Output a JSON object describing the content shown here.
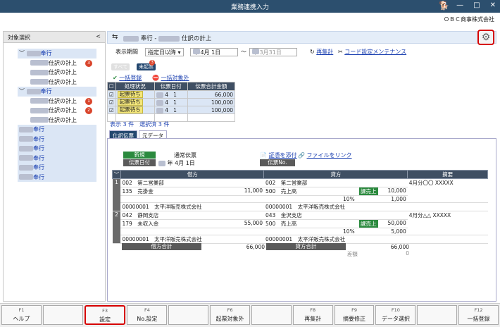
{
  "window": {
    "title": "業務連携入力",
    "company": "ＯＢＣ商事株式会社"
  },
  "left_panel": {
    "title": "対象選択",
    "collapse": "<",
    "tree": [
      {
        "label": "奉行",
        "type": "bank",
        "indent": 0,
        "expand": "﹀"
      },
      {
        "label": "仕訳の計上",
        "indent": 1,
        "badge": "3",
        "badge_color": "#d9442b"
      },
      {
        "label": "仕訳の計上",
        "indent": 1
      },
      {
        "label": "仕訳の計上",
        "indent": 1
      },
      {
        "label": "奉行",
        "type": "bank",
        "indent": 0,
        "expand": "﹀"
      },
      {
        "label": "仕訳の計上",
        "indent": 1,
        "badge": "1",
        "badge_color": "#d9442b"
      },
      {
        "label": "仕訳の計上",
        "indent": 1,
        "badge": "2",
        "badge_color": "#d9442b"
      },
      {
        "label": "仕訳の計上",
        "indent": 1
      },
      {
        "label": "奉行",
        "type": "bank",
        "indent": 0
      },
      {
        "label": "奉行",
        "type": "bank",
        "indent": 0
      },
      {
        "label": "奉行",
        "type": "bank",
        "indent": 0
      },
      {
        "label": "奉行",
        "type": "bank",
        "indent": 0
      },
      {
        "label": "奉行",
        "type": "bank",
        "indent": 0
      },
      {
        "label": "奉行",
        "type": "bank",
        "indent": 0
      }
    ]
  },
  "main": {
    "header": {
      "bank": "奉行",
      "separator": "-",
      "entry": "仕訳の計上"
    },
    "filter": {
      "period_label": "表示期間",
      "period_select": "指定日以降",
      "from_date": "年  4月  1日",
      "tilde": "～",
      "to_date": "年  3月31日",
      "recalc": "再集計",
      "code_setting": "コード設定メンテナンス"
    },
    "chips": {
      "all": "すべて",
      "unposted": "未起票",
      "unposted_count": "3"
    },
    "actions": {
      "bulk_register": "一括登録",
      "bulk_exclude": "一括対象外"
    },
    "list": {
      "columns": [
        "処理状況",
        "伝票日付",
        "伝票合計金額"
      ],
      "rows": [
        {
          "status": "起票待ち",
          "month": "4",
          "day": "1",
          "amount": "66,000"
        },
        {
          "status": "起票待ち",
          "month": "4",
          "day": "1",
          "amount": "100,000"
        },
        {
          "status": "起票待ち",
          "month": "4",
          "day": "1",
          "amount": "100,000"
        }
      ],
      "summary": "表示 3 件　選択済 3 件"
    },
    "detail": {
      "tabs": [
        "仕訳伝票",
        "元データ"
      ],
      "new_button": "新規",
      "voucher_type": "通常伝票",
      "date_label": "伝票日付",
      "date_value": "年  4月  1日",
      "voucher_no_label": "伝票No.",
      "attach": "証憑を添付",
      "file_link": "ファイルをリンク",
      "columns": {
        "debit": "借方",
        "credit": "貸方",
        "memo": "摘要"
      },
      "entries": [
        {
          "no": "1",
          "debit_dept": "002　第二営業部",
          "debit_acct": "135　売掛金",
          "debit_amount": "11,000",
          "debit_partner": "00000001　太平洋販売株式会社",
          "credit_dept": "002　第二営業部",
          "credit_acct": "500　売上高",
          "credit_tax": "課売上",
          "credit_rate": "10%",
          "credit_amount": "10,000",
          "credit_tax_amount": "1,000",
          "credit_partner": "00000001　太平洋販売株式会社",
          "memo": "4月分〇〇 XXXXX"
        },
        {
          "no": "2",
          "debit_dept": "042　静岡支店",
          "debit_acct": "179　未収入金",
          "debit_amount": "55,000",
          "debit_partner": "00000001　太平洋販売株式会社",
          "credit_dept": "043　金沢支店",
          "credit_acct": "500　売上高",
          "credit_tax": "課売上",
          "credit_rate": "10%",
          "credit_amount": "50,000",
          "credit_tax_amount": "5,000",
          "credit_partner": "00000001　太平洋販売株式会社",
          "memo": "4月分△△ XXXXX"
        }
      ],
      "totals": {
        "debit_label": "借方合計",
        "debit_value": "66,000",
        "credit_label": "貸方合計",
        "credit_value": "66,000",
        "diff_label": "差額",
        "diff_value": "0"
      }
    }
  },
  "fkeys": [
    {
      "key": "F1",
      "label": "ヘルプ"
    },
    {
      "key": "",
      "label": ""
    },
    {
      "key": "F3",
      "label": "設定",
      "highlight": true
    },
    {
      "key": "F4",
      "label": "No.設定"
    },
    {
      "key": "",
      "label": ""
    },
    {
      "key": "F6",
      "label": "起票対象外"
    },
    {
      "key": "",
      "label": ""
    },
    {
      "key": "F8",
      "label": "再集計"
    },
    {
      "key": "F9",
      "label": "摘要修正"
    },
    {
      "key": "F10",
      "label": "データ選択"
    },
    {
      "key": "",
      "label": ""
    },
    {
      "key": "F12",
      "label": "一括登録"
    }
  ]
}
